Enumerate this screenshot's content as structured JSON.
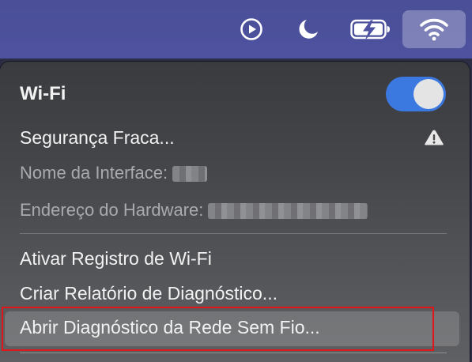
{
  "menubar": {
    "icons": [
      "play-circle-icon",
      "moon-icon",
      "battery-charging-icon",
      "wifi-icon"
    ]
  },
  "wifi_menu": {
    "title": "Wi-Fi",
    "toggle_on": true,
    "network_label": "Segurança Fraca...",
    "interface_label": "Nome da Interface:",
    "hardware_label": "Endereço do Hardware:",
    "items": [
      "Ativar Registro de Wi-Fi",
      "Criar Relatório de Diagnóstico...",
      "Abrir Diagnóstico da Rede Sem Fio..."
    ]
  },
  "colors": {
    "accent": "#3b78e0",
    "menubar": "#4e52a0",
    "highlight_box": "#e0161b"
  }
}
